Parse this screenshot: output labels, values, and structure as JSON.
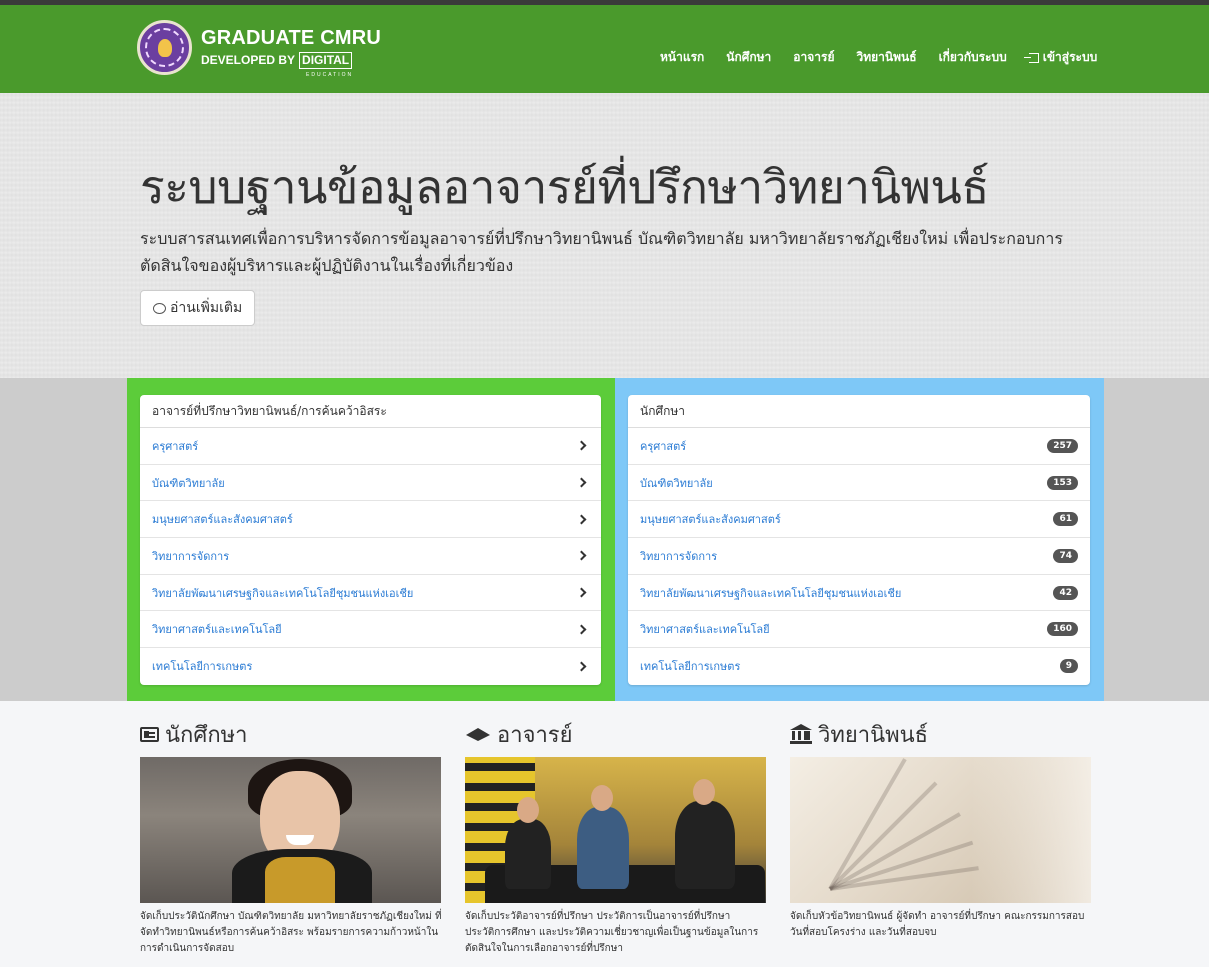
{
  "brand": {
    "title": "GRADUATE CMRU",
    "developed_by": "DEVELOPED BY",
    "digital": "DIGITAL",
    "education": "EDUCATION"
  },
  "nav": {
    "items": [
      "หน้าแรก",
      "นักศึกษา",
      "อาจารย์",
      "วิทยานิพนธ์",
      "เกี่ยวกับระบบ"
    ],
    "login": "เข้าสู่ระบบ"
  },
  "hero": {
    "title": "ระบบฐานข้อมูลอาจารย์ที่ปรึกษาวิทยานิพนธ์",
    "description": "ระบบสารสนเทศเพื่อการบริหารจัดการข้อมูลอาจารย์ที่ปรึกษาวิทยานิพนธ์ บัณฑิตวิทยาลัย มหาวิทยาลัยราชภัฏเชียงใหม่ เพื่อประกอบการตัดสินใจของผู้บริหารและผู้ปฏิบัติงานในเรื่องที่เกี่ยวข้อง",
    "button": "อ่านเพิ่มเติม"
  },
  "advisors_panel": {
    "heading": "อาจารย์ที่ปรึกษาวิทยานิพนธ์/การค้นคว้าอิสระ",
    "items": [
      "ครุศาสตร์",
      "บัณฑิตวิทยาลัย",
      "มนุษยศาสตร์และสังคมศาสตร์",
      "วิทยาการจัดการ",
      "วิทยาลัยพัฒนาเศรษฐกิจและเทคโนโลยีชุมชนแห่งเอเชีย",
      "วิทยาศาสตร์และเทคโนโลยี",
      "เทคโนโลยีการเกษตร"
    ]
  },
  "students_panel": {
    "heading": "นักศึกษา",
    "items": [
      {
        "label": "ครุศาสตร์",
        "count": "257"
      },
      {
        "label": "บัณฑิตวิทยาลัย",
        "count": "153"
      },
      {
        "label": "มนุษยศาสตร์และสังคมศาสตร์",
        "count": "61"
      },
      {
        "label": "วิทยาการจัดการ",
        "count": "74"
      },
      {
        "label": "วิทยาลัยพัฒนาเศรษฐกิจและเทคโนโลยีชุมชนแห่งเอเชีย",
        "count": "42"
      },
      {
        "label": "วิทยาศาสตร์และเทคโนโลยี",
        "count": "160"
      },
      {
        "label": "เทคโนโลยีการเกษตร",
        "count": "9"
      }
    ]
  },
  "features": [
    {
      "title": "นักศึกษา",
      "icon": "id-card-icon",
      "text": "จัดเก็บประวัตินักศึกษา บัณฑิตวิทยาลัย มหาวิทยาลัยราชภัฏเชียงใหม่ ที่จัดทำวิทยานิพนธ์หรือการค้นคว้าอิสระ พร้อมรายการความก้าวหน้าในการดำเนินการจัดสอบ"
    },
    {
      "title": "อาจารย์",
      "icon": "graduation-cap-icon",
      "text": "จัดเก็บประวัติอาจารย์ที่ปรึกษา ประวัติการเป็นอาจารย์ที่ปรึกษา ประวัติการศึกษา และประวัติความเชี่ยวชาญเพื่อเป็นฐานข้อมูลในการตัดสินใจในการเลือกอาจารย์ที่ปรึกษา"
    },
    {
      "title": "วิทยานิพนธ์",
      "icon": "institution-icon",
      "text": "จัดเก็บหัวข้อวิทยานิพนธ์ ผู้จัดทำ อาจารย์ที่ปรึกษา คณะกรรมการสอบ วันที่สอบโครงร่าง และวันที่สอบจบ"
    }
  ],
  "colors": {
    "navbar": "#4a9a2c",
    "panel_green": "#5ccc3a",
    "panel_blue": "#7ec8f7",
    "link": "#2a7bd4"
  }
}
